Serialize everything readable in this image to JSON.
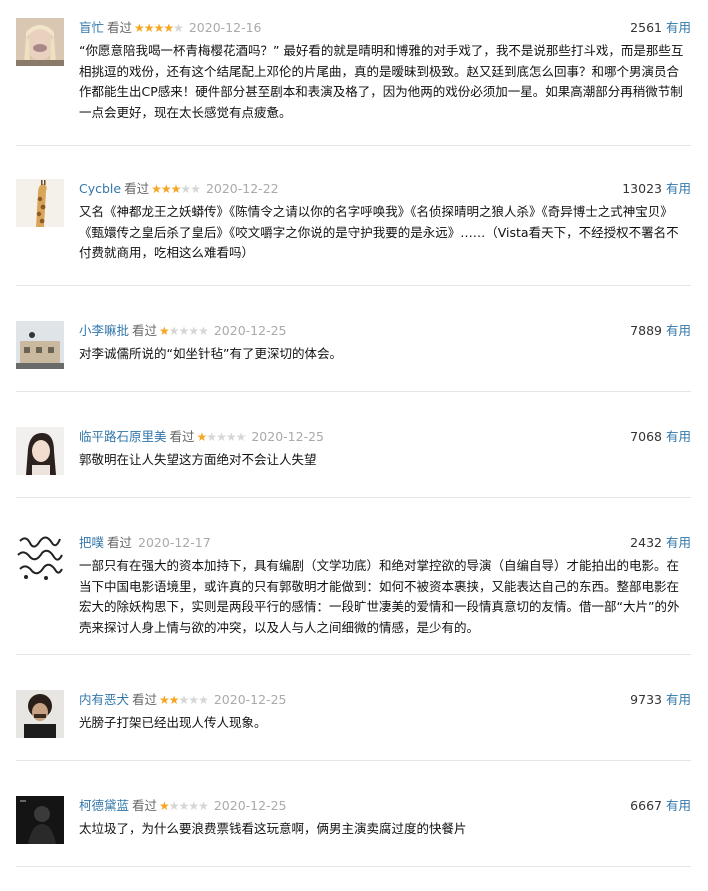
{
  "useful_label": "有用",
  "watched_label": "看过",
  "comments": [
    {
      "user": "盲忙",
      "rating": 4,
      "date": "2020-12-16",
      "votes": "2561",
      "avatar": "avatar-blond-person",
      "text": "“你愿意陪我喝一杯青梅樱花酒吗？” 最好看的就是晴明和博雅的对手戏了，我不是说那些打斗戏，而是那些互相挑逗的戏份，还有这个结尾配上邓伦的片尾曲，真的是暧昧到极致。赵又廷到底怎么回事？和哪个男演员合作都能生出CP感来！硬件部分甚至剧本和表演及格了，因为他两的戏份必须加一星。如果高潮部分再稍微节制一点会更好，现在太长感觉有点疲惫。"
    },
    {
      "user": "Cycble",
      "rating": 3,
      "date": "2020-12-22",
      "votes": "13023",
      "avatar": "avatar-giraffe",
      "text": "又名《神都龙王之妖蟒传》《陈情令之请以你的名字呼唤我》《名侦探晴明之狼人杀》《奇异博士之式神宝贝》《甄嬛传之皇后杀了皇后》《咬文嚼字之你说的是守护我要的是永远》……（Vista看天下，不经授权不署名不付费就商用，吃相这么难看吗）"
    },
    {
      "user": "小李嘛批",
      "rating": 1,
      "date": "2020-12-25",
      "votes": "7889",
      "avatar": "avatar-building",
      "text": "对李诚儒所说的“如坐针毡”有了更深切的体会。"
    },
    {
      "user": "临平路石原里美",
      "rating": 1,
      "date": "2020-12-25",
      "votes": "7068",
      "avatar": "avatar-girl",
      "text": "郭敬明在让人失望这方面绝对不会让人失望"
    },
    {
      "user": "把噗",
      "rating": 0,
      "date": "2020-12-17",
      "votes": "2432",
      "avatar": "avatar-sketch",
      "text": "一部只有在强大的资本加持下，具有编剧（文学功底）和绝对掌控欲的导演（自编自导）才能拍出的电影。在当下中国电影语境里，或许真的只有郭敬明才能做到：如何不被资本裹挟，又能表达自己的东西。整部电影在宏大的除妖构思下，实则是两段平行的感情：一段旷世凄美的爱情和一段情真意切的友情。借一部“大片”的外壳来探讨人身上情与欲的冲突，以及人与人之间细微的情感，是少有的。"
    },
    {
      "user": "内有恶犬",
      "rating": 2,
      "date": "2020-12-25",
      "votes": "9733",
      "avatar": "avatar-curly-man",
      "text": "光膀子打架已经出现人传人现象。"
    },
    {
      "user": "柯德黛蓝",
      "rating": 1,
      "date": "2020-12-25",
      "votes": "6667",
      "avatar": "avatar-dark-figure",
      "text": "太垃圾了，为什么要浪费票钱看这玩意啊，俩男主演卖腐过度的快餐片"
    }
  ]
}
